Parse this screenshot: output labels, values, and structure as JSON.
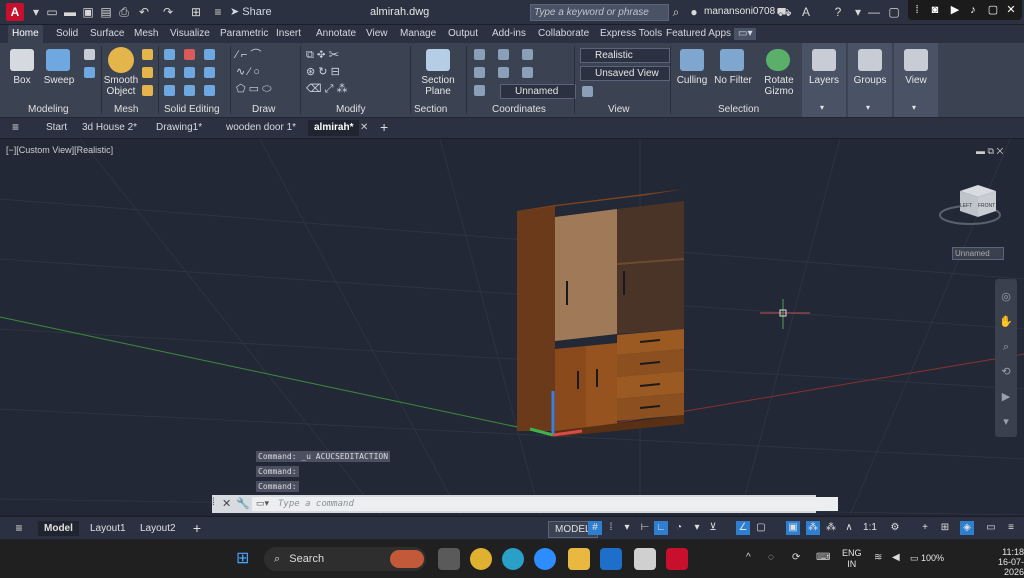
{
  "app": {
    "file_name": "almirah.dwg",
    "share_label": "Share",
    "search_placeholder": "Type a keyword or phrase",
    "user_name": "manansoni0708"
  },
  "ribbon_tabs": [
    "Home",
    "Solid",
    "Surface",
    "Mesh",
    "Visualize",
    "Parametric",
    "Insert",
    "Annotate",
    "View",
    "Manage",
    "Output",
    "Add-ins",
    "Collaborate",
    "Express Tools",
    "Featured Apps"
  ],
  "ribbon": {
    "modeling": {
      "title": "Modeling",
      "box": "Box",
      "sweep": "Sweep"
    },
    "mesh": {
      "title": "Mesh",
      "smooth_object": "Smooth Object"
    },
    "solid_editing": {
      "title": "Solid Editing"
    },
    "draw": {
      "title": "Draw"
    },
    "modify": {
      "title": "Modify"
    },
    "section": {
      "title": "Section",
      "section_plane": "Section Plane"
    },
    "coordinates": {
      "title": "Coordinates",
      "ucs_value": "Unnamed"
    },
    "view": {
      "title": "View",
      "visual_style": "Realistic",
      "named_view": "Unsaved View"
    },
    "selection": {
      "title": "Selection",
      "culling": "Culling",
      "no_filter": "No Filter",
      "rotate_gizmo": "Rotate Gizmo"
    },
    "layers": "Layers",
    "groups": "Groups",
    "view_panel": "View"
  },
  "file_tabs": [
    "Start",
    "3d House 2*",
    "Drawing1*",
    "wooden door 1*",
    "almirah*"
  ],
  "viewport": {
    "label": "[−][Custom View][Realistic]",
    "viewcube_left": "LEFT",
    "viewcube_front": "FRONT",
    "ucs_dropdown": "Unnamed"
  },
  "command_history": [
    "Command: _u ACUCSEDITACTION",
    "Command:",
    "Command:"
  ],
  "command_placeholder": "Type a command",
  "status": {
    "layout_tabs": [
      "Model",
      "Layout1",
      "Layout2"
    ],
    "model_label": "MODEL",
    "scale": "1:1"
  },
  "taskbar": {
    "search_label": "Search",
    "language": "ENG",
    "region": "IN",
    "battery": "100%",
    "time": "11:18",
    "date": "16-07-2026"
  },
  "colors": {
    "accent": "#2f7fd1",
    "autocad_red": "#c8102e",
    "wood_dark": "#8a4a1c",
    "wood_light": "#b88a60"
  }
}
